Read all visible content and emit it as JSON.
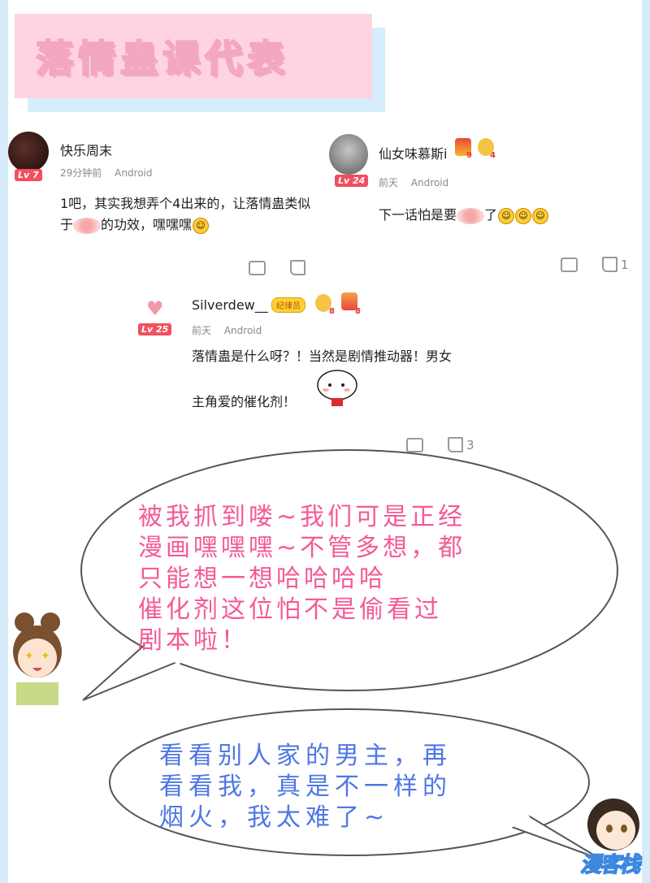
{
  "page_title": "落情蛊课代表",
  "comments": [
    {
      "username": "快乐周末",
      "level": "Lv 7",
      "time": "29分钟前",
      "platform": "Android",
      "text_line1": "1吧，其实我想弄个4出来的，让落情蛊类似",
      "text_line2_pre": "于",
      "text_line2_post": "的功效，嘿嘿嘿"
    },
    {
      "username": "仙女味慕斯i",
      "level": "Lv 24",
      "time": "前天",
      "platform": "Android",
      "text_pre": "下一话怕是要",
      "text_post": "了",
      "medal1": "9",
      "medal2": "4",
      "like_count": "1"
    },
    {
      "username": "Silverdew__",
      "tag": "纪律员",
      "level": "Lv 25",
      "time": "前天",
      "platform": "Android",
      "text_line1": "落情蛊是什么呀？！当然是剧情推动器！男女",
      "text_line2": "主角爱的催化剂！",
      "medal1": "8",
      "medal2": "8",
      "like_count": "3"
    }
  ],
  "bubble1": {
    "lines": [
      "被我抓到喽~我们可是正经",
      "漫画嘿嘿嘿~不管多想，都",
      "只能想一想哈哈哈哈",
      "催化剂这位怕不是偷看过",
      "剧本啦！"
    ]
  },
  "bubble2": {
    "lines": [
      "看看别人家的男主，再",
      "看看我，真是不一样的",
      "烟火，我太难了~"
    ]
  },
  "logo_text": "漫客栈",
  "colors": {
    "title_bg": "#ffd4e1",
    "title_text": "#ffe94f",
    "pink_text": "#f45a98",
    "blue_text": "#4f77e5",
    "frame": "#d7ecfb"
  }
}
